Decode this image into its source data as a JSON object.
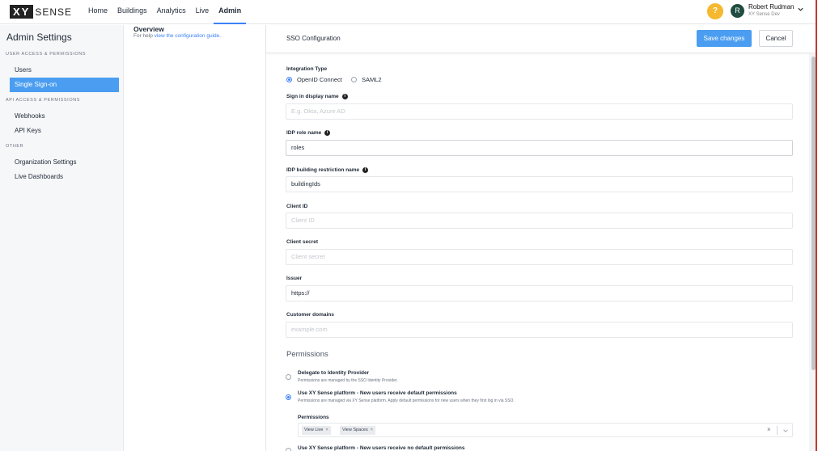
{
  "logo": {
    "xy": "XY",
    "sense": "SENSE"
  },
  "nav": {
    "items": [
      "Home",
      "Buildings",
      "Analytics",
      "Live",
      "Admin"
    ],
    "active": "Admin"
  },
  "user": {
    "initial": "R",
    "name": "Robert Rudman",
    "org": "XY Sense Dev",
    "help": "?"
  },
  "sidebar": {
    "title": "Admin Settings",
    "sections": [
      {
        "label": "USER ACCESS & PERMISSIONS",
        "items": [
          "Users",
          "Single Sign-on"
        ]
      },
      {
        "label": "API ACCESS & PERMISSIONS",
        "items": [
          "Webhooks",
          "API Keys"
        ]
      },
      {
        "label": "OTHER",
        "items": [
          "Organization Settings",
          "Live Dashboards"
        ]
      }
    ],
    "active_item": "Single Sign-on"
  },
  "overview": {
    "title": "Overview",
    "help_prefix": "For help ",
    "help_link": "view the configuration guide."
  },
  "panel": {
    "title": "SSO Configuration",
    "save_label": "Save changes",
    "cancel_label": "Cancel",
    "integration": {
      "label": "Integration Type",
      "options": [
        "OpenID Connect",
        "SAML2"
      ],
      "selected": "OpenID Connect"
    },
    "fields": {
      "display_name": {
        "label": "Sign in display name",
        "value": "",
        "placeholder": "E.g. Okta, Azure AD"
      },
      "idp_role": {
        "label": "IDP role name",
        "value": "roles"
      },
      "idp_building": {
        "label": "IDP building restriction name",
        "value": "buildingIds"
      },
      "client_id": {
        "label": "Client ID",
        "value": "",
        "placeholder": "Client ID"
      },
      "client_secret": {
        "label": "Client secret",
        "value": "",
        "placeholder": "Client secret"
      },
      "issuer": {
        "label": "Issuer",
        "value": "https://"
      },
      "customer_domains": {
        "label": "Customer domains",
        "value": "",
        "placeholder": "example.com"
      }
    },
    "permissions": {
      "heading": "Permissions",
      "options": [
        {
          "title": "Delegate to Identity Provider",
          "desc": "Permissions are managed by the SSO Identity Provider."
        },
        {
          "title": "Use XY Sense platform - New users receive default permissions",
          "desc": "Permissions are managed via XY Sense platform. Apply default permissions for new users when they first log in via SSO."
        },
        {
          "title": "Use XY Sense platform - New users receive no default permissions",
          "desc": ""
        }
      ],
      "selected_index": 1,
      "default_label": "Permissions",
      "tags": [
        "View Live",
        "View Spaces"
      ]
    }
  },
  "colors": {
    "accent": "#4a9df0",
    "help": "#f5b82e",
    "avatar": "#1f4d3f"
  }
}
